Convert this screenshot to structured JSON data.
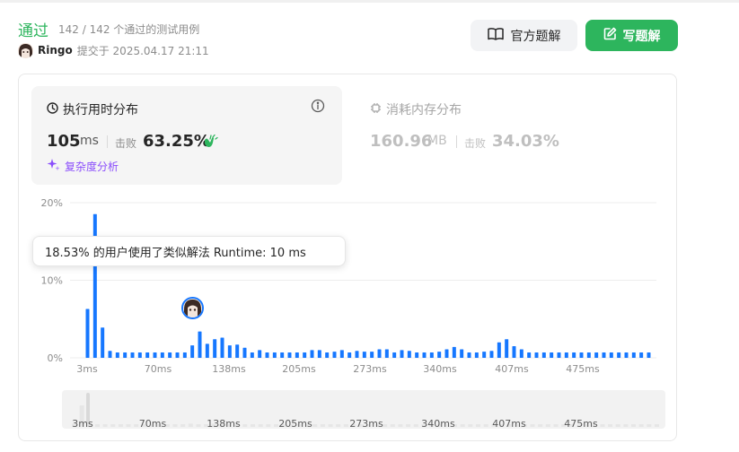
{
  "submission": {
    "status": "通过",
    "testcases": "142 / 142 个通过的测试用例",
    "author": "Ringo",
    "submitted_label": "提交于 2025.04.17 21:11"
  },
  "buttons": {
    "official_label": "官方题解",
    "write_label": "写题解"
  },
  "runtime": {
    "title": "执行用时分布",
    "value": "105",
    "unit": "ms",
    "beat_label": "击败",
    "beat_value": "63.25%",
    "complexity_label": "复杂度分析"
  },
  "memory": {
    "title": "消耗内存分布",
    "value": "160.96",
    "unit": "MB",
    "beat_label": "击败",
    "beat_value": "34.03%"
  },
  "tooltip": {
    "text": "18.53% 的用户使用了类似解法 Runtime: 10 ms"
  },
  "colors": {
    "accent_green": "#2db55d",
    "bar_blue": "#1677ff",
    "complexity_purple": "#8a4dfc"
  },
  "chart_data": {
    "type": "bar",
    "yticks": [
      "20%",
      "10%",
      "0%"
    ],
    "ylim": [
      0,
      20
    ],
    "xticks": [
      "3ms",
      "70ms",
      "138ms",
      "205ms",
      "273ms",
      "340ms",
      "407ms",
      "475ms"
    ],
    "slider_ticks": [
      "3ms",
      "70ms",
      "138ms",
      "205ms",
      "273ms",
      "340ms",
      "407ms",
      "475ms"
    ],
    "highlight_index": 14,
    "values": [
      6.3,
      18.53,
      3.9,
      0.9,
      0.7,
      0.7,
      0.7,
      0.7,
      0.7,
      0.7,
      0.7,
      0.7,
      0.7,
      0.7,
      1.6,
      3.4,
      1.8,
      2.4,
      2.6,
      1.6,
      1.7,
      1.3,
      0.7,
      1.0,
      0.7,
      0.7,
      0.7,
      0.7,
      0.7,
      0.7,
      1.0,
      1.0,
      0.7,
      0.8,
      1.0,
      0.7,
      0.9,
      0.8,
      0.8,
      1.1,
      1.1,
      0.7,
      1.0,
      0.9,
      0.7,
      0.7,
      0.7,
      0.8,
      1.1,
      1.4,
      1.1,
      0.7,
      0.7,
      0.8,
      0.9,
      2.0,
      2.4,
      1.5,
      1.1,
      0.7,
      0.7,
      0.7,
      0.7,
      0.7,
      0.7,
      0.7,
      0.7,
      0.7,
      0.7,
      0.7,
      0.7,
      0.7,
      0.7,
      0.7,
      0.7,
      0.7
    ],
    "slider_values": [
      3,
      20,
      3,
      1,
      1,
      1,
      1,
      1,
      1,
      1,
      1,
      1,
      1,
      1,
      2,
      3,
      2,
      2,
      3,
      2,
      2,
      2,
      1,
      1,
      1,
      1,
      1,
      1,
      1,
      1,
      1,
      1,
      1,
      1,
      1,
      1,
      1,
      1,
      1,
      1,
      1,
      1,
      1,
      1,
      1,
      1,
      1,
      1,
      1,
      2,
      1,
      1,
      1,
      1,
      1,
      2,
      2,
      2,
      1,
      1,
      1,
      1,
      1,
      1,
      1,
      1,
      1,
      1,
      1,
      1,
      1,
      1,
      1,
      1,
      1,
      1
    ]
  }
}
